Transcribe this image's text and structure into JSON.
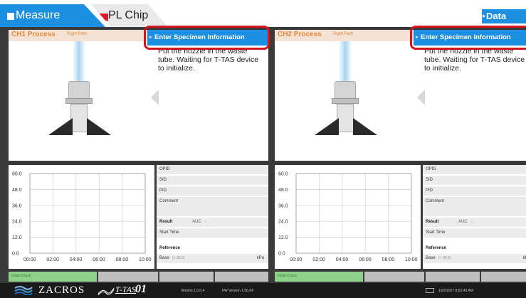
{
  "tabs": {
    "measure": "Measure",
    "chip": "PL Chip",
    "data": "Data"
  },
  "channels": [
    {
      "title": "CH1 Process",
      "path": "Right Path",
      "enter_button": "Enter Specimen Information",
      "message": "Put the nozzle in the waste tube. Waiting for T-TAS device to initialize.",
      "info": {
        "opid": "OPID",
        "sid": "SID",
        "pid": "PID",
        "comment": "Comment",
        "result_label": "Result",
        "result_metric": "AUC",
        "start_time": "Start Time",
        "reference": "Reference",
        "base": "Base",
        "base_value": "(< 30.0)",
        "unit": "kPa"
      }
    },
    {
      "title": "CH2 Process",
      "path": "Right Path",
      "enter_button": "Enter Specimen Information",
      "message": "Put the nozzle in the waste tube. Waiting for T-TAS device to initialize.",
      "info": {
        "opid": "OPID",
        "sid": "SID",
        "pid": "PID",
        "comment": "Comment",
        "result_label": "Result",
        "result_metric": "AUC",
        "start_time": "Start Time",
        "reference": "Reference",
        "base": "Base",
        "base_value": "(< 30.0)",
        "unit": "kPa"
      }
    }
  ],
  "chart_data": [
    {
      "type": "line",
      "x_ticks": [
        "00:00",
        "02:00",
        "04:00",
        "06:00",
        "08:00",
        "10:00"
      ],
      "y_ticks": [
        "0.0",
        "12.0",
        "24.0",
        "36.0",
        "48.0",
        "60.0"
      ],
      "ylim": [
        0,
        60
      ],
      "grid": true,
      "series": []
    },
    {
      "type": "line",
      "x_ticks": [
        "00:00",
        "02:00",
        "04:00",
        "06:00",
        "08:00",
        "10:00"
      ],
      "y_ticks": [
        "0.0",
        "12.0",
        "24.0",
        "36.0",
        "48.0",
        "60.0"
      ],
      "ylim": [
        0,
        60
      ],
      "grid": true,
      "series": []
    }
  ],
  "bottom_buttons": [
    "Initial Check",
    "",
    "",
    ""
  ],
  "footer": {
    "brand": "ZACROS",
    "product": "T-TAS",
    "product_num": "01",
    "version": "Version 1.0.0.4",
    "fw_version": "FW Version 1.00.04",
    "datetime": "10/2/2017 8:01:43 AM"
  },
  "colors": {
    "accent_blue": "#1d8fe0",
    "process_orange": "#e08a3c",
    "highlight_red": "#d5151e",
    "chip_red": "#e4142a",
    "background_dark": "#3a3a3a"
  },
  "icons": [
    "nozzle-illustration",
    "keyboard-icon",
    "zacros-wave-logo"
  ]
}
